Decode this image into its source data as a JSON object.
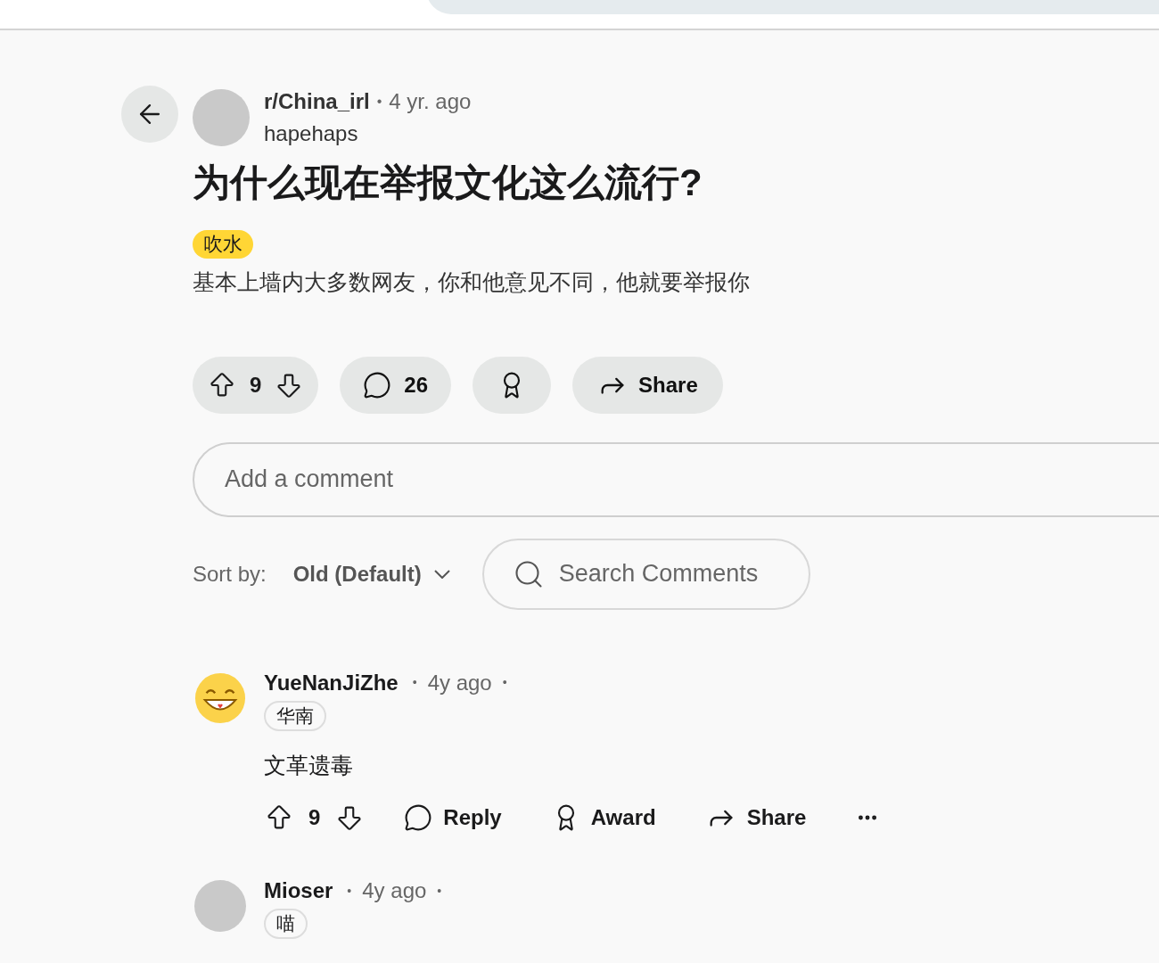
{
  "post": {
    "subreddit": "r/China_irl",
    "separator": "•",
    "time": "4 yr. ago",
    "author": "hapehaps",
    "title": "为什么现在举报文化这么流行?",
    "flair": "吹水",
    "body": "基本上墙内大多数网友，你和他意见不同，他就要举报你"
  },
  "actions": {
    "votes": "9",
    "comments": "26",
    "share": "Share"
  },
  "comment_box": {
    "placeholder": "Add a comment"
  },
  "sort": {
    "label": "Sort by:",
    "value": "Old (Default)"
  },
  "search": {
    "placeholder": "Search Comments"
  },
  "comments": [
    {
      "author": "YueNanJiZhe",
      "time": "4y ago",
      "flair": "华南",
      "kind": "smiley",
      "body": "文革遗毒",
      "votes": "9",
      "reply": "Reply",
      "award": "Award",
      "share": "Share"
    },
    {
      "author": "Mioser",
      "time": "4y ago",
      "flair": "喵",
      "kind": "drawing"
    }
  ]
}
